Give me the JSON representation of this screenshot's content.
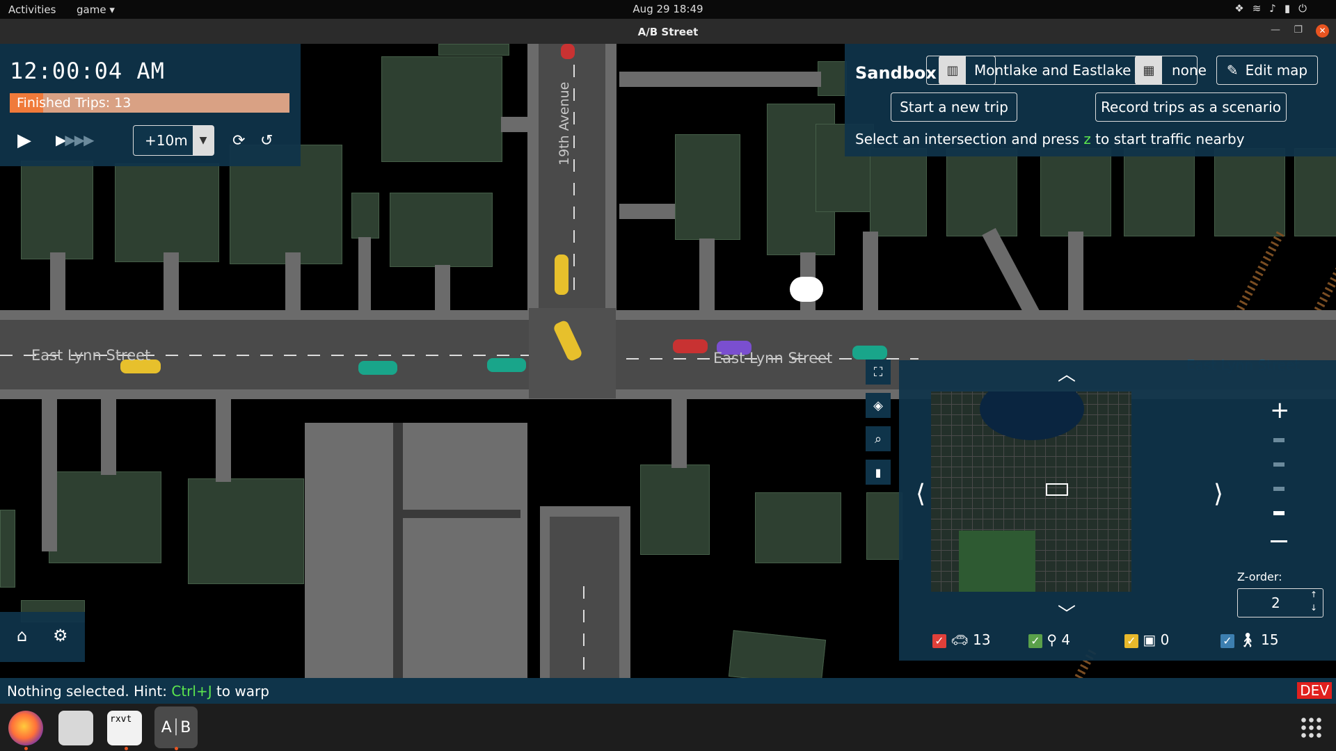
{
  "system_bar": {
    "activities": "Activities",
    "app_menu": "game",
    "datetime": "Aug 29  18:49"
  },
  "window": {
    "title": "A/B Street"
  },
  "time_panel": {
    "clock": "12:00:04 AM",
    "finished_trips": "Finished Trips: 13",
    "finished_progress": 0.12,
    "step_value": "+10m"
  },
  "sandbox_panel": {
    "title": "Sandbox",
    "map_name": "Montlake and Eastlake",
    "scenario": "none",
    "edit_map": "Edit map",
    "start_trip": "Start a new trip",
    "record_trips": "Record trips as a scenario",
    "hint_prefix": "Select an intersection and press ",
    "hint_key": "z",
    "hint_suffix": " to start traffic nearby"
  },
  "map": {
    "street_labels": [
      "East Lynn Street",
      "East Lynn Street",
      "19th Avenue"
    ],
    "faded_label": "East Lynn Street"
  },
  "minimap": {
    "zorder_label": "Z-order:",
    "zorder_value": "2",
    "filters": [
      {
        "name": "cars",
        "count": "13",
        "color": "#e0403a",
        "icon": "car-icon"
      },
      {
        "name": "bikes",
        "count": "4",
        "color": "#5aa04a",
        "icon": "bike-icon"
      },
      {
        "name": "buses",
        "count": "0",
        "color": "#e8b92c",
        "icon": "bus-icon"
      },
      {
        "name": "pedestrians",
        "count": "15",
        "color": "#3d7fb0",
        "icon": "pedestrian-icon"
      }
    ]
  },
  "status_bar": {
    "prefix": "Nothing selected. Hint: ",
    "hotkey": "Ctrl+J",
    "suffix": " to warp",
    "dev": "DEV"
  },
  "dock": {
    "terminal_label": "rxvt"
  },
  "colors": {
    "panel": "#0f344a",
    "progress_fill": "#f07a3a",
    "progress_bg": "#d9a184",
    "hotkey_green": "#5ce64e",
    "dev_red": "#e0201e",
    "building": "#2e4031"
  }
}
